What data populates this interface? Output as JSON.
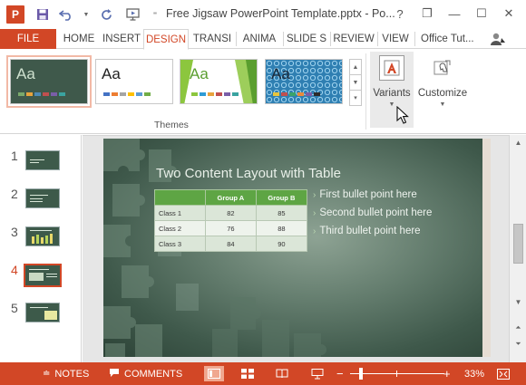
{
  "window": {
    "title": "Free Jigsaw PowerPoint Template.pptx - Po...",
    "app_logo": "P",
    "controls": [
      "?",
      "❐",
      "—",
      "☐",
      "✕"
    ]
  },
  "quick_access": {
    "save_icon": "save-icon",
    "undo_icon": "undo-icon",
    "redo_icon": "redo-icon",
    "present_icon": "start-from-beginning-icon",
    "customize_icon": "chevron-down-icon"
  },
  "tabs": {
    "file": "FILE",
    "items": [
      "HOME",
      "INSERT",
      "DESIGN",
      "TRANSI",
      "ANIMA",
      "SLIDE S",
      "REVIEW",
      "VIEW"
    ],
    "active": "DESIGN",
    "account": "Office Tut..."
  },
  "ribbon": {
    "themes_label": "Themes",
    "themes": [
      {
        "label": "Aa",
        "bg": "#3f594b",
        "text_color": "#cfe1cf",
        "colors": [
          "#7aa96b",
          "#e8a33d",
          "#4d8ab5",
          "#c04f4f",
          "#7a5ea8",
          "#3aa3a0"
        ]
      },
      {
        "label": "Aa",
        "bg": "#ffffff",
        "text_color": "#222222",
        "colors": [
          "#4472c4",
          "#ed7d31",
          "#a5a5a5",
          "#ffc000",
          "#5b9bd5",
          "#70ad47"
        ]
      },
      {
        "label": "Aa",
        "bg": "#ffffff",
        "text_color": "#5a9e2f",
        "colors": [
          "#8cc63e",
          "#2e9bd6",
          "#e8a33d",
          "#c04f4f",
          "#7a5ea8",
          "#3aa3a0"
        ]
      },
      {
        "label": "Aa",
        "bg": "#2f7fb2",
        "text_color": "#1c2a3a",
        "colors": [
          "#e8c43d",
          "#c04f4f",
          "#3aa36a",
          "#e88a3d",
          "#7a5ea8",
          "#2c2c2c"
        ]
      }
    ],
    "variants_label": "Variants",
    "customize_label": "Customize"
  },
  "slides": {
    "numbers": [
      "1",
      "2",
      "3",
      "4",
      "5"
    ],
    "active_index": 3
  },
  "slide": {
    "title": "Two Content Layout with Table",
    "table": {
      "headers": [
        "",
        "Group A",
        "Group B"
      ],
      "rows": [
        [
          "Class 1",
          "82",
          "85"
        ],
        [
          "Class 2",
          "76",
          "88"
        ],
        [
          "Class 3",
          "84",
          "90"
        ]
      ]
    },
    "bullets": [
      "First bullet point here",
      "Second bullet point here",
      "Third bullet point here"
    ]
  },
  "status": {
    "notes": "NOTES",
    "comments": "COMMENTS",
    "zoom": "33%",
    "zoom_minus": "−",
    "zoom_plus": "+",
    "zoom_level_fraction": 0.33
  },
  "colors": {
    "accent": "#d24726",
    "table_header": "#5ea544"
  }
}
